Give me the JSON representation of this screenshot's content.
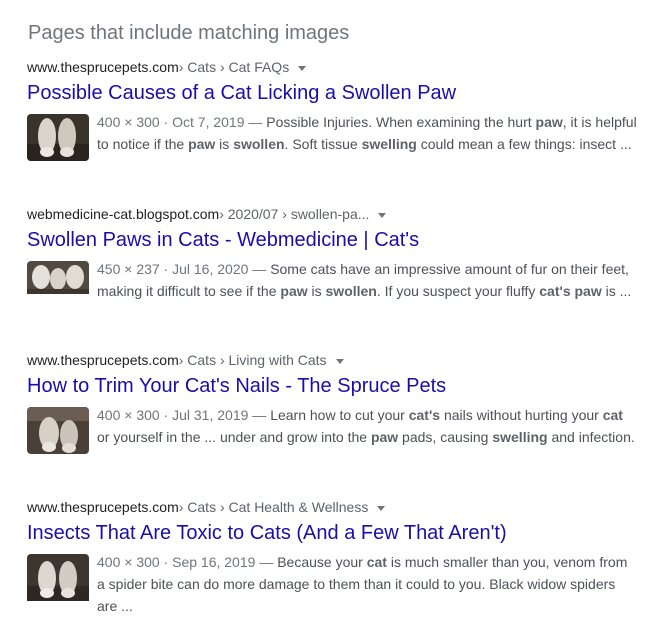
{
  "heading": "Pages that include matching images",
  "results": [
    {
      "site": "www.thesprucepets.com",
      "path": " › Cats › Cat FAQs",
      "title": "Possible Causes of a Cat Licking a Swollen Paw",
      "meta": "400 × 300 · Oct 7, 2019 — ",
      "snippet": [
        {
          "t": "Possible Injuries. When examining the hurt "
        },
        {
          "b": "paw"
        },
        {
          "t": ", it is helpful to notice if the "
        },
        {
          "b": "paw"
        },
        {
          "t": " is "
        },
        {
          "b": "swollen"
        },
        {
          "t": ". Soft tissue "
        },
        {
          "b": "swelling"
        },
        {
          "t": " could mean a few things: insect ..."
        }
      ]
    },
    {
      "site": "webmedicine-cat.blogspot.com",
      "path": " › 2020/07 › swollen-pa...",
      "title": "Swollen Paws in Cats - Webmedicine | Cat's",
      "meta": "450 × 237 · Jul 16, 2020 — ",
      "snippet": [
        {
          "t": "Some cats have an impressive amount of fur on their feet, making it difficult to see if the "
        },
        {
          "b": "paw"
        },
        {
          "t": " is "
        },
        {
          "b": "swollen"
        },
        {
          "t": ". If you suspect your fluffy "
        },
        {
          "b": "cat's paw"
        },
        {
          "t": " is ..."
        }
      ]
    },
    {
      "site": "www.thesprucepets.com",
      "path": " › Cats › Living with Cats",
      "title": "How to Trim Your Cat's Nails - The Spruce Pets",
      "meta": "400 × 300 · Jul 31, 2019 — ",
      "snippet": [
        {
          "t": "Learn how to cut your "
        },
        {
          "b": "cat's"
        },
        {
          "t": " nails without hurting your "
        },
        {
          "b": "cat"
        },
        {
          "t": " or yourself in the ... under and grow into the "
        },
        {
          "b": "paw"
        },
        {
          "t": " pads, causing "
        },
        {
          "b": "swelling"
        },
        {
          "t": " and infection."
        }
      ]
    },
    {
      "site": "www.thesprucepets.com",
      "path": " › Cats › Cat Health & Wellness",
      "title": "Insects That Are Toxic to Cats (And a Few That Aren't)",
      "meta": "400 × 300 · Sep 16, 2019 — ",
      "snippet": [
        {
          "t": "Because your "
        },
        {
          "b": "cat"
        },
        {
          "t": " is much smaller than you, venom from a spider bite can do more damage to them than it could to you. Black widow spiders are ..."
        }
      ]
    }
  ]
}
